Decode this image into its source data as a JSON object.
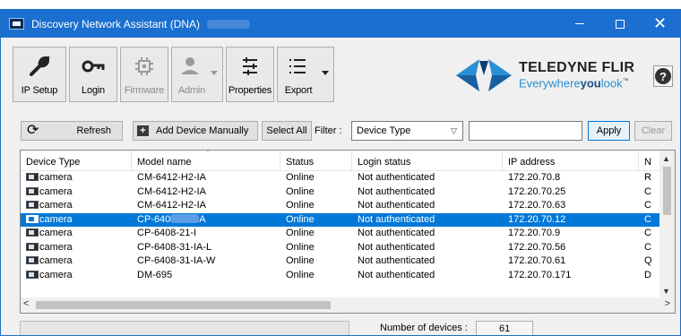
{
  "window": {
    "title": "Discovery Network Assistant (DNA)"
  },
  "toolbar": {
    "ip_setup": "IP Setup",
    "login": "Login",
    "firmware": "Firmware",
    "admin": "Admin",
    "properties": "Properties",
    "export": "Export"
  },
  "logo": {
    "line1": "TELEDYNE FLIR",
    "line2_a": "Everywhere",
    "line2_b": "you",
    "line2_c": "look",
    "tm": "™"
  },
  "help": {
    "label": "?"
  },
  "actions": {
    "refresh": "Refresh",
    "add_device": "Add Device Manually",
    "select_all": "Select All",
    "filter_label": "Filter :",
    "filter_select": "Device Type",
    "filter_value": "",
    "apply": "Apply",
    "clear": "Clear"
  },
  "table": {
    "columns": [
      "Device Type",
      "Model name",
      "Status",
      "Login status",
      "IP address",
      "N"
    ],
    "rows": [
      {
        "type": "camera",
        "model": "CM-6412-H2-IA",
        "status": "Online",
        "login": "Not authenticated",
        "ip": "172.20.70.8",
        "n": "R"
      },
      {
        "type": "camera",
        "model": "CM-6412-H2-IA",
        "status": "Online",
        "login": "Not authenticated",
        "ip": "172.20.70.25",
        "n": "C"
      },
      {
        "type": "camera",
        "model": "CM-6412-H2-IA",
        "status": "Online",
        "login": "Not authenticated",
        "ip": "172.20.70.63",
        "n": "C"
      },
      {
        "type": "camera",
        "model_a": "CP-640",
        "model_b": "A",
        "status": "Online",
        "login": "Not authenticated",
        "ip": "172.20.70.12",
        "n": "C"
      },
      {
        "type": "camera",
        "model": "CP-6408-21-I",
        "status": "Online",
        "login": "Not authenticated",
        "ip": "172.20.70.9",
        "n": "C"
      },
      {
        "type": "camera",
        "model": "CP-6408-31-IA-L",
        "status": "Online",
        "login": "Not authenticated",
        "ip": "172.20.70.56",
        "n": "C"
      },
      {
        "type": "camera",
        "model": "CP-6408-31-IA-W",
        "status": "Online",
        "login": "Not authenticated",
        "ip": "172.20.70.61",
        "n": "Q"
      },
      {
        "type": "camera",
        "model": "DM-695",
        "status": "Online",
        "login": "Not authenticated",
        "ip": "172.20.70.171",
        "n": "D"
      }
    ]
  },
  "status": {
    "count_label": "Number of devices :",
    "count_value": "61"
  }
}
